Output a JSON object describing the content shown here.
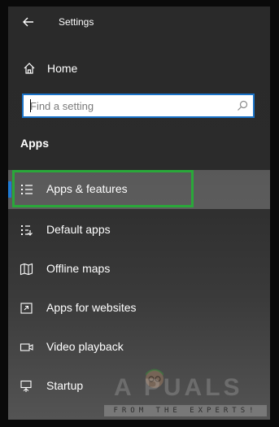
{
  "window": {
    "title": "Settings",
    "back_icon": "back-arrow-icon"
  },
  "home": {
    "label": "Home",
    "icon": "home-icon"
  },
  "search": {
    "placeholder": "Find a setting",
    "value": "",
    "icon": "search-icon"
  },
  "section": {
    "heading": "Apps"
  },
  "nav": {
    "items": [
      {
        "label": "Apps & features",
        "icon": "apps-features-icon",
        "selected": true
      },
      {
        "label": "Default apps",
        "icon": "default-apps-icon",
        "selected": false
      },
      {
        "label": "Offline maps",
        "icon": "offline-maps-icon",
        "selected": false
      },
      {
        "label": "Apps for websites",
        "icon": "apps-for-websites-icon",
        "selected": false
      },
      {
        "label": "Video playback",
        "icon": "video-playback-icon",
        "selected": false
      },
      {
        "label": "Startup",
        "icon": "startup-icon",
        "selected": false
      }
    ]
  },
  "watermark": {
    "brand": "A PUALS",
    "tagline": "FROM THE EXPERTS!"
  },
  "colors": {
    "accent_blue": "#1f7ad3",
    "highlight_green": "#2aa83a",
    "search_border": "#1a73c8"
  }
}
